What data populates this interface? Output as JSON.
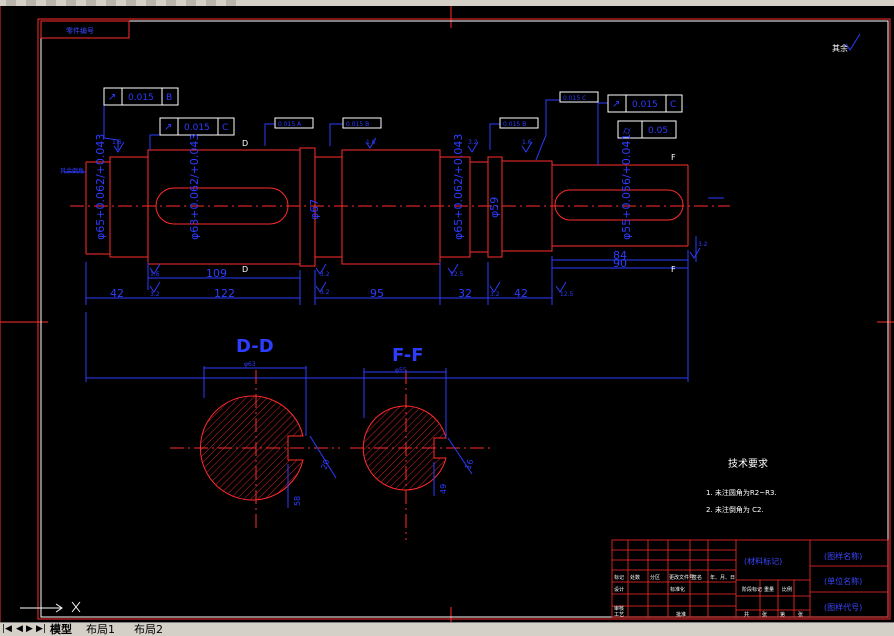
{
  "colors": {
    "background": "#000000",
    "border": "#ff2b2b",
    "dimension": "#2d3cff",
    "part_outline": "#ff2b2b",
    "centerline": "#ff2b2b",
    "text": "#ffffff",
    "title_block_text": "#3a46ff"
  },
  "toolbar": {
    "icon_names": [
      "new-icon",
      "open-icon",
      "save-icon",
      "print-icon",
      "undo-icon",
      "redo-icon",
      "pan-icon",
      "zoom-icon",
      "properties-icon",
      "layer-icon",
      "match-icon",
      "help-icon"
    ]
  },
  "drawing": {
    "top_left_tag": "零件编号",
    "roughness_note": "其余",
    "left_end_label": "其余倒角",
    "views": {
      "section_d": "D-D",
      "section_f": "F-F"
    },
    "section_markers": {
      "d_top": "D",
      "d_bottom": "D",
      "f_top": "F",
      "f_bottom": "F"
    },
    "tolerance_frames": [
      {
        "symbol": "↗",
        "value": "0.015",
        "datum": "B"
      },
      {
        "symbol": "↗",
        "value": "0.015",
        "datum": "C"
      },
      {
        "symbol": "↗",
        "value": "0.015",
        "datum": "C"
      },
      {
        "symbol": "⌭",
        "value": "0.05",
        "datum": ""
      }
    ],
    "small_frames": [
      "0.015 A",
      "0.015 B",
      "0.015 B",
      "0.015 C"
    ],
    "diameters": [
      "φ65+0.062/+0.043",
      "φ63+0.062/+0.043",
      "φ67",
      "φ65+0.062/+0.043",
      "φ59",
      "φ55+0.056/+0.041"
    ],
    "lengths": [
      "42",
      "122",
      "109",
      "95",
      "32",
      "42",
      "84",
      "90"
    ],
    "roughness_values": [
      "1.6",
      "1.6",
      "3.2",
      "3.2",
      "1.6",
      "3.2",
      "12.5",
      "3.2",
      "3.2",
      "1.6",
      "12.5",
      "3.2"
    ],
    "section_dims": [
      "φ63",
      "20",
      "58",
      "φ55",
      "16",
      "49"
    ],
    "tech_requirements": {
      "title": "技术要求",
      "items": [
        "1. 未注圆角为R2~R3.",
        "2. 未注倒角为 C2."
      ]
    },
    "title_block": {
      "material_label": "(材料标记)",
      "unit_name": "(单位名称)",
      "drawing_name": "(图样名称)",
      "drawing_code": "(图样代号)",
      "headers": [
        "标记",
        "处数",
        "分区",
        "更改文件号",
        "签名",
        "年、月、日"
      ],
      "rows": [
        "设计",
        "审核",
        "工艺"
      ],
      "cells": [
        "标准化",
        "批准",
        "阶段标记",
        "重量",
        "比例",
        "共",
        "张",
        "第",
        "张"
      ]
    }
  },
  "tabs": {
    "nav": [
      "|◀",
      "◀",
      "▶",
      "▶|"
    ],
    "model": "模型",
    "layout1": "布局1",
    "layout2": "布局2"
  }
}
